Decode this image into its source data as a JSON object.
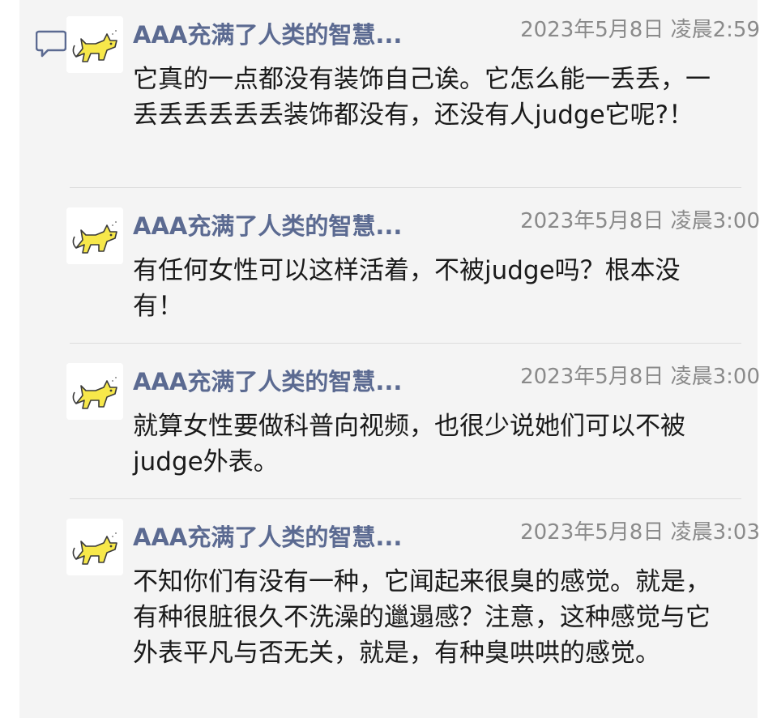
{
  "thread": {
    "icon": "comment-icon",
    "messages": [
      {
        "avatar": "yellow-cat-avatar",
        "name": "AAA充满了人类的智慧...",
        "time": "2023年5月8日 凌晨2:59",
        "text": "它真的一点都没有装饰自己诶。它怎么能一丢丢，一丢丢丢丢丢丢装饰都没有，还没有人judge它呢?！"
      },
      {
        "avatar": "yellow-cat-avatar",
        "name": "AAA充满了人类的智慧...",
        "time": "2023年5月8日 凌晨3:00",
        "text": "有任何女性可以这样活着，不被judge吗？根本没有！"
      },
      {
        "avatar": "yellow-cat-avatar",
        "name": "AAA充满了人类的智慧...",
        "time": "2023年5月8日 凌晨3:00",
        "text": "就算女性要做科普向视频，也很少说她们可以不被judge外表。"
      },
      {
        "avatar": "yellow-cat-avatar",
        "name": "AAA充满了人类的智慧...",
        "time": "2023年5月8日 凌晨3:03",
        "text": "不知你们有没有一种，它闻起来很臭的感觉。就是，有种很脏很久不洗澡的邋遢感？注意，这种感觉与它外表平凡与否无关，就是，有种臭哄哄的感觉。"
      }
    ]
  },
  "colors": {
    "panel_bg": "#f4f4f4",
    "name": "#5b6a91",
    "time": "#8a8a8a",
    "text": "#1a1a1a",
    "avatar_cat": "#f7e84a"
  }
}
